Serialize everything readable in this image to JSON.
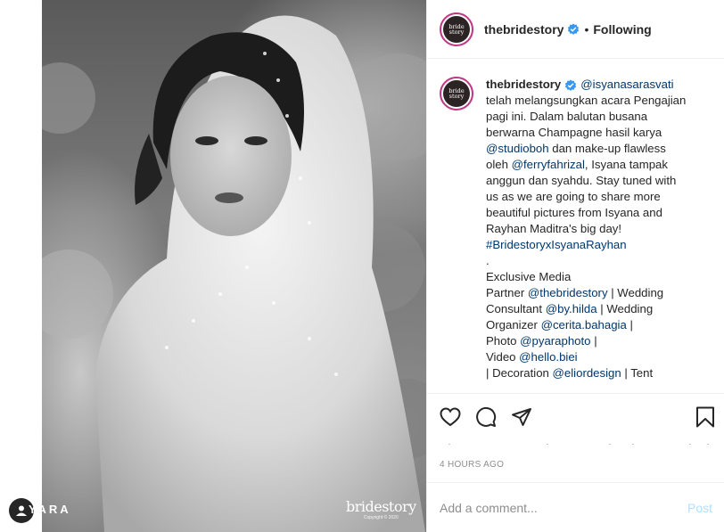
{
  "photo": {
    "watermark_left": "YARA",
    "brand_mark": "bridestory",
    "brand_copyright": "Copyright © 2020"
  },
  "header": {
    "username": "thebridestory",
    "avatar_text_1": "bride",
    "avatar_text_2": "story",
    "separator": "•",
    "follow_state": "Following"
  },
  "caption": {
    "username": "thebridestory",
    "lines": [
      {
        "mention": "@isyanasarasvati",
        "text": ""
      },
      {
        "text": "telah melangsungkan acara Pengajian"
      },
      {
        "text": "pagi ini. Dalam balutan busana"
      },
      {
        "text": "berwarna Champagne hasil karya"
      },
      {
        "mention": "@studioboh",
        "text": " dan make-up flawless"
      },
      {
        "pre": "oleh ",
        "mention": "@ferryfahrizal",
        "text": ", Isyana tampak"
      },
      {
        "text": "anggun dan syahdu. Stay tuned with"
      },
      {
        "text": "us as we are going to share more"
      },
      {
        "text": "beautiful pictures from Isyana and"
      },
      {
        "text": "Rayhan Maditra's big day!"
      },
      {
        "mention": "#BridestoryxIsyanaRayhan",
        "text": ""
      },
      {
        "text": "."
      },
      {
        "text": "Exclusive Media"
      },
      {
        "pre": "Partner ",
        "mention": "@thebridestory",
        "text": " | Wedding"
      },
      {
        "pre": "Consultant ",
        "mention": "@by.hilda",
        "text": " | Wedding"
      },
      {
        "pre": "Organizer ",
        "mention": "@cerita.bahagia",
        "text": " |"
      },
      {
        "pre": "Photo ",
        "mention": "@pyaraphoto",
        "text": " |"
      },
      {
        "pre": "Video ",
        "mention": "@hello.biei",
        "text": ""
      },
      {
        "pre": "| Decoration ",
        "mention": "@eliordesign",
        "text": " | Tent"
      }
    ]
  },
  "actions": {
    "like_icon": "heart-icon",
    "comment_icon": "comment-icon",
    "share_icon": "share-icon",
    "save_icon": "bookmark-icon"
  },
  "timestamp": "4 HOURS AGO",
  "comment_box": {
    "placeholder": "Add a comment...",
    "post_label": "Post"
  },
  "colors": {
    "mention": "#00376b",
    "verified": "#3897f0",
    "post_disabled": "#b2dffc",
    "muted": "#8e8e8e"
  }
}
